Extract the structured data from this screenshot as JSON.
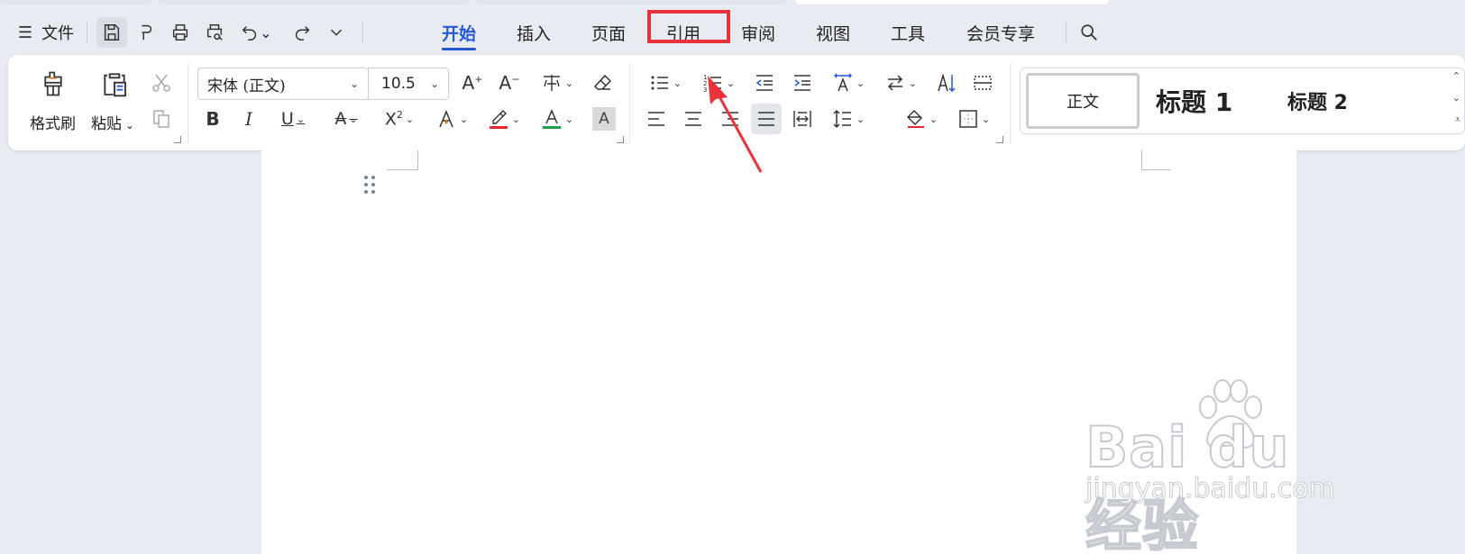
{
  "menubar": {
    "file_label": "文件",
    "tabs": [
      "开始",
      "插入",
      "页面",
      "引用",
      "审阅",
      "视图",
      "工具",
      "会员专享"
    ],
    "active_tab": "开始",
    "highlighted_tab": "引用",
    "accent_color": "#2456d6",
    "highlight_color": "#e8333a"
  },
  "ribbon": {
    "format_painter_label": "格式刷",
    "paste_label": "粘贴",
    "font_name": "宋体 (正文)",
    "font_size": "10.5",
    "font_color_bar": "#e8282e",
    "highlight_bar": "#e8282e",
    "green_color_bar": "#1aa04a"
  },
  "styles": {
    "normal": "正文",
    "heading1": "标题  1",
    "heading2": "标题  2"
  },
  "watermark": {
    "logo": "Bai du 经验",
    "sub": "jingyan.baidu.com"
  }
}
